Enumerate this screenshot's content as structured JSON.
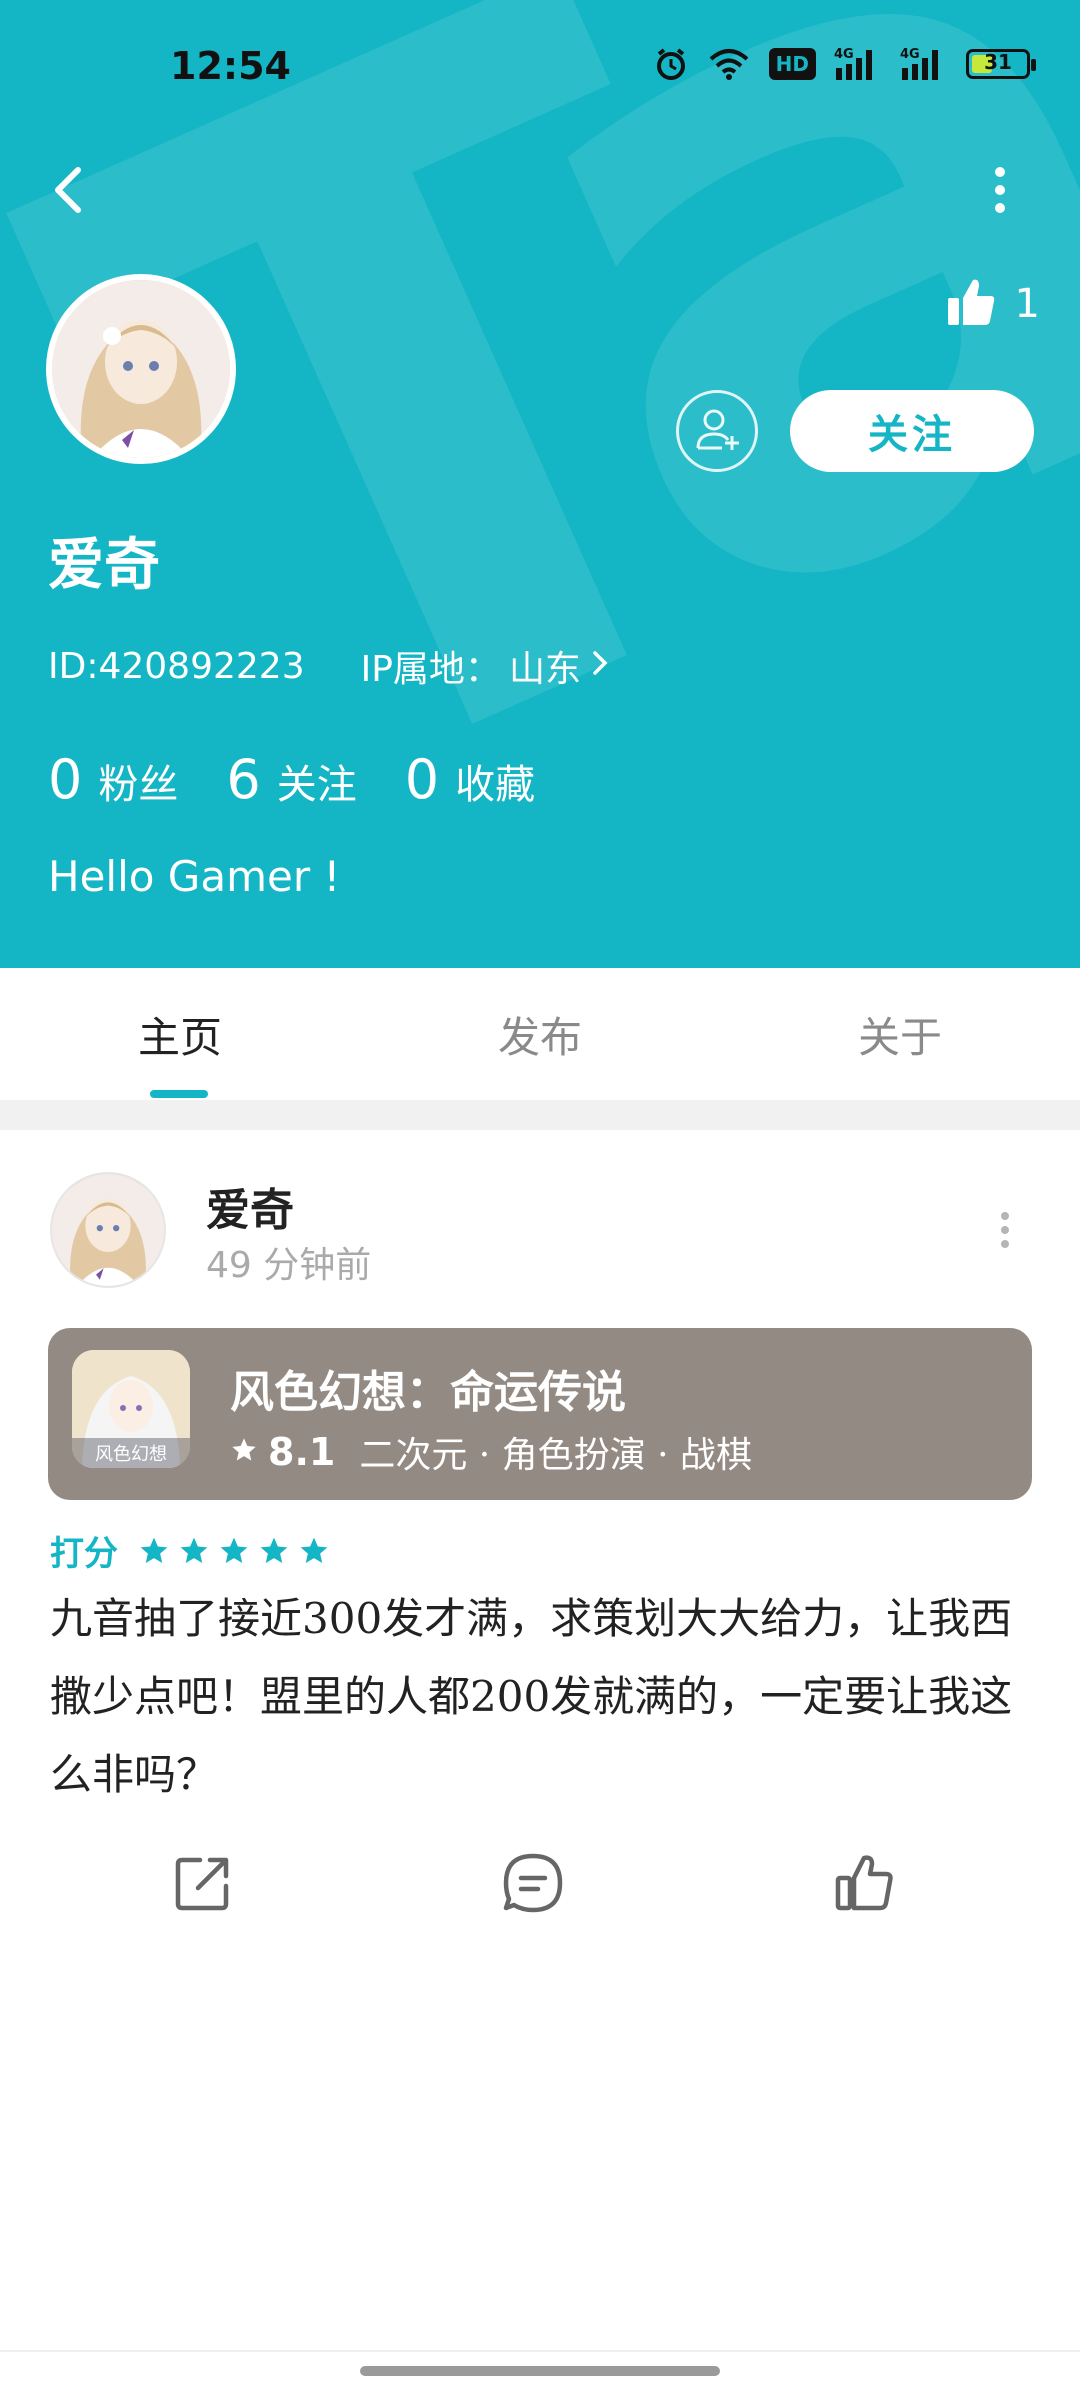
{
  "status_bar": {
    "time": "12:54",
    "hd": "HD",
    "signal1": "4G",
    "signal2": "4G",
    "battery": "31"
  },
  "profile": {
    "like_count": "1",
    "follow_label": "关注",
    "username": "爱奇",
    "id": "ID:420892223",
    "ip_label": "IP属地：",
    "ip_value": "山东",
    "stats": [
      {
        "num": "0",
        "label": "粉丝"
      },
      {
        "num": "6",
        "label": "关注"
      },
      {
        "num": "0",
        "label": "收藏"
      }
    ],
    "bio": "Hello Gamer !"
  },
  "tabs": [
    "主页",
    "发布",
    "关于"
  ],
  "active_tab": 0,
  "post": {
    "author": "爱奇",
    "time": "49 分钟前",
    "game": {
      "title": "风色幻想：命运传说",
      "score": "8.1",
      "tags": "二次元 · 角色扮演 · 战棋",
      "icon_text": "风色幻想"
    },
    "rating_label": "打分",
    "rating_stars": 5,
    "text": "九音抽了接近300发才满，求策划大大给力，让我西撒少点吧！盟里的人都200发就满的，一定要让我这么非吗？"
  },
  "colors": {
    "accent": "#14b6c5",
    "card": "#948a84"
  },
  "icons": {
    "back": "chevron-left-icon",
    "more": "more-vertical-icon",
    "like": "thumb-up-icon",
    "add_friend": "add-user-icon",
    "share": "share-icon",
    "comment": "comment-icon"
  }
}
